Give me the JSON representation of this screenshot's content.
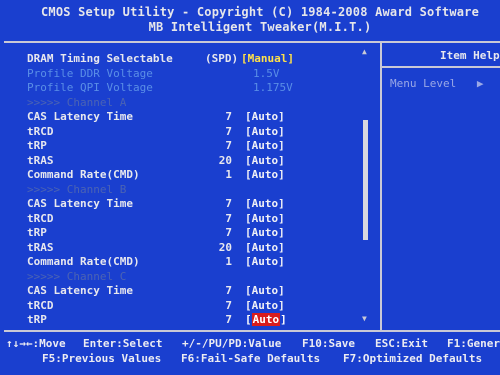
{
  "header": {
    "title_line1": "CMOS Setup Utility - Copyright (C) 1984-2008 Award Software",
    "title_line2": "MB Intelligent Tweaker(M.I.T.)"
  },
  "settings": [
    {
      "label": "DRAM Timing Selectable",
      "spd": "(SPD)",
      "value": "[Manual]",
      "style": "normal",
      "value_style": "yellow"
    },
    {
      "label": "Profile DDR Voltage",
      "value": "1.5V",
      "style": "dim",
      "value_style": "dim"
    },
    {
      "label": "Profile QPI Voltage",
      "value": "1.175V",
      "style": "dim",
      "value_style": "dim"
    },
    {
      "label": ">>>>> Channel A",
      "style": "grey"
    },
    {
      "label": "CAS Latency Time",
      "num": "7",
      "value": "[Auto]",
      "style": "normal"
    },
    {
      "label": "tRCD",
      "num": "7",
      "value": "[Auto]",
      "style": "normal"
    },
    {
      "label": "tRP",
      "num": "7",
      "value": "[Auto]",
      "style": "normal"
    },
    {
      "label": "tRAS",
      "num": "20",
      "value": "[Auto]",
      "style": "normal"
    },
    {
      "label": "Command Rate(CMD)",
      "num": "1",
      "value": "[Auto]",
      "style": "normal"
    },
    {
      "label": ">>>>> Channel B",
      "style": "grey"
    },
    {
      "label": "CAS Latency Time",
      "num": "7",
      "value": "[Auto]",
      "style": "normal"
    },
    {
      "label": "tRCD",
      "num": "7",
      "value": "[Auto]",
      "style": "normal"
    },
    {
      "label": "tRP",
      "num": "7",
      "value": "[Auto]",
      "style": "normal"
    },
    {
      "label": "tRAS",
      "num": "20",
      "value": "[Auto]",
      "style": "normal"
    },
    {
      "label": "Command Rate(CMD)",
      "num": "1",
      "value": "[Auto]",
      "style": "normal"
    },
    {
      "label": ">>>>> Channel C",
      "style": "grey"
    },
    {
      "label": "CAS Latency Time",
      "num": "7",
      "value": "[Auto]",
      "style": "normal"
    },
    {
      "label": "tRCD",
      "num": "7",
      "value": "[Auto]",
      "style": "normal"
    },
    {
      "label": "tRP",
      "num": "7",
      "value_pre": "[",
      "value_hl": "Auto",
      "value_post": "]",
      "style": "normal",
      "selected": true
    }
  ],
  "help": {
    "title": "Item Help",
    "menu_level": "Menu Level",
    "menu_arrow": "▶"
  },
  "footer": {
    "row1": [
      {
        "key": "↑↓→←:Move"
      },
      {
        "key": "Enter:Select"
      },
      {
        "key": "+/-/PU/PD:Value"
      },
      {
        "key": "F10:Save"
      },
      {
        "key": "ESC:Exit"
      },
      {
        "key": "F1:General Help"
      }
    ],
    "row2": [
      {
        "key": "F5:Previous Values"
      },
      {
        "key": "F6:Fail-Safe Defaults"
      },
      {
        "key": "F7:Optimized Defaults"
      }
    ]
  },
  "scrollbar": {
    "up": "▲",
    "down": "▼"
  },
  "colors": {
    "background": "#1a3fcf",
    "text": "#e8e8ee",
    "selected_value": "#ffe14a",
    "highlight": "#d81c1c",
    "disabled": "#5a8ee6"
  }
}
